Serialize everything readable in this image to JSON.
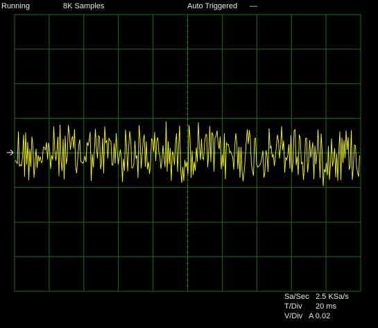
{
  "status": {
    "run_state": "Running",
    "samples": "8K Samples",
    "trigger": "Auto Triggered",
    "trigger_indicator": "—"
  },
  "readout": {
    "sample_rate_label": "Sa/Sec",
    "sample_rate_value": "2.5 KSa/s",
    "time_div_label": "T/Div",
    "time_div_value": "20 ms",
    "volt_div_label": "V/Div",
    "volt_div_value": "A 0.02"
  },
  "colors": {
    "grid": "#1f6b1f",
    "trace": "#ffff00",
    "marker": "#ffffff",
    "background": "#000000"
  },
  "icons": {
    "ground_marker": "right-arrow-icon"
  },
  "trace": {
    "channel": "A",
    "ground_level_div": 0,
    "peak_amplitude_div": 1.0
  }
}
